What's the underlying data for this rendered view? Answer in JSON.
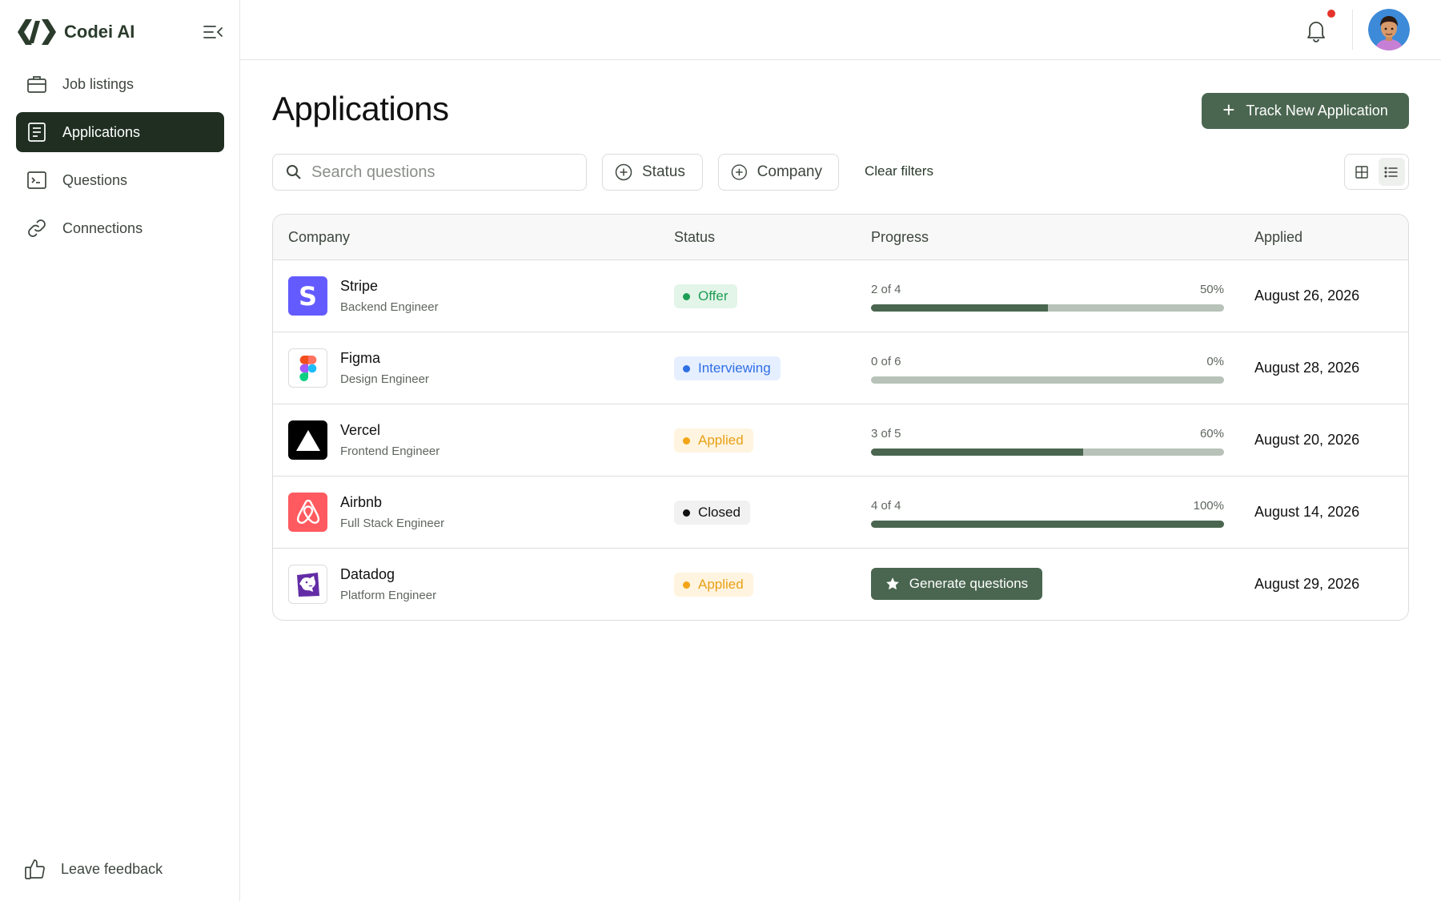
{
  "brand": {
    "name": "Codei AI"
  },
  "sidebar": {
    "items": [
      {
        "label": "Job listings",
        "icon": "briefcase-icon",
        "active": false
      },
      {
        "label": "Applications",
        "icon": "document-icon",
        "active": true
      },
      {
        "label": "Questions",
        "icon": "terminal-icon",
        "active": false
      },
      {
        "label": "Connections",
        "icon": "link-icon",
        "active": false
      }
    ],
    "feedback_label": "Leave feedback"
  },
  "header": {
    "notification_unread": true
  },
  "page": {
    "title": "Applications",
    "track_button_label": "Track New Application"
  },
  "filters": {
    "search_placeholder": "Search questions",
    "status_label": "Status",
    "company_label": "Company",
    "clear_label": "Clear filters",
    "view_mode": "list"
  },
  "table": {
    "columns": [
      "Company",
      "Status",
      "Progress",
      "Applied"
    ],
    "rows": [
      {
        "company": "Stripe",
        "role": "Backend Engineer",
        "status": "Offer",
        "progress_text": "2 of 4",
        "progress_pct": "50%",
        "progress_value": 0.5,
        "applied": "August 26, 2026"
      },
      {
        "company": "Figma",
        "role": "Design Engineer",
        "status": "Interviewing",
        "progress_text": "0 of 6",
        "progress_pct": "0%",
        "progress_value": 0,
        "applied": "August 28, 2026"
      },
      {
        "company": "Vercel",
        "role": "Frontend Engineer",
        "status": "Applied",
        "progress_text": "3 of 5",
        "progress_pct": "60%",
        "progress_value": 0.6,
        "applied": "August 20, 2026"
      },
      {
        "company": "Airbnb",
        "role": "Full Stack Engineer",
        "status": "Closed",
        "progress_text": "4 of 4",
        "progress_pct": "100%",
        "progress_value": 1,
        "applied": "August 14, 2026"
      },
      {
        "company": "Datadog",
        "role": "Platform Engineer",
        "status": "Applied",
        "generate_label": "Generate questions",
        "applied": "August 29, 2026"
      }
    ]
  },
  "colors": {
    "accent": "#4a6650",
    "sidebar_active": "#1f2e21",
    "status_offer": "#1f9d55",
    "status_interviewing": "#2f6fe4",
    "status_applied": "#f2a516",
    "status_closed": "#111111"
  }
}
